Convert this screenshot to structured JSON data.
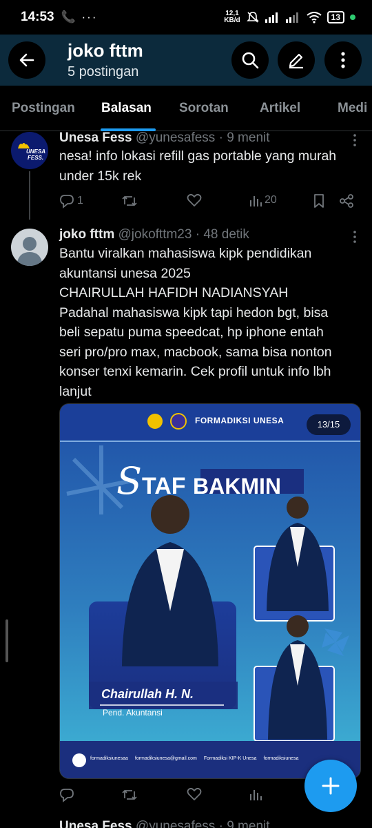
{
  "status_bar": {
    "time": "14:53",
    "left_icons": "📞 ···",
    "net_speed_value": "12,1",
    "net_speed_unit": "KB/d",
    "battery": "13"
  },
  "header": {
    "profile_name": "joko fttm",
    "post_count": "5 postingan"
  },
  "tabs": [
    "Postingan",
    "Balasan",
    "Sorotan",
    "Artikel",
    "Medi"
  ],
  "active_tab": "Balasan",
  "posts": [
    {
      "display_name": "Unesa Fess",
      "handle": "@yunesafess",
      "time": "· 9 menit",
      "avatar_text": "UNESA FESS.",
      "text": "nesa! info lokasi refill gas portable yang murah under 15k rek",
      "replies": "1",
      "views": "20"
    },
    {
      "display_name": "joko fttm",
      "handle": "@jokofttm23",
      "time": "· 48 detik",
      "text_lines": [
        "Bantu viralkan mahasiswa kipk pendidikan",
        "akuntansi unesa 2025",
        "CHAIRULLAH HAFIDH NADIANSYAH",
        "Padahal mahasiswa kipk tapi hedon bgt, bisa",
        "beli sepatu puma speedcat, hp iphone entah",
        "seri pro/pro max, macbook, sama bisa nonton",
        "konser tenxi kemarin. Cek profil untuk info lbh",
        "lanjut"
      ],
      "media": {
        "org": "FORMADIKSI UNESA",
        "page_indicator": "13/15",
        "headline_script": "S",
        "headline_rest": "TAF",
        "headline_box": "BAKMIN",
        "person_name": "Chairullah H. N.",
        "person_dept": "Pend. Akuntansi",
        "footer_ig": "formadiksiunesaa",
        "footer_email": "formadiksiunesa@gmail.com",
        "footer_yt": "Formadiksi KIP-K Unesa",
        "footer_tiktok": "formadiksiunesa"
      }
    },
    {
      "display_name": "Unesa Fess",
      "handle": "@yunesafess",
      "time": "· 9 menit"
    }
  ],
  "colors": {
    "accent": "#1d9bf0",
    "header_bg": "#0c2a3c",
    "muted": "#71767b"
  }
}
